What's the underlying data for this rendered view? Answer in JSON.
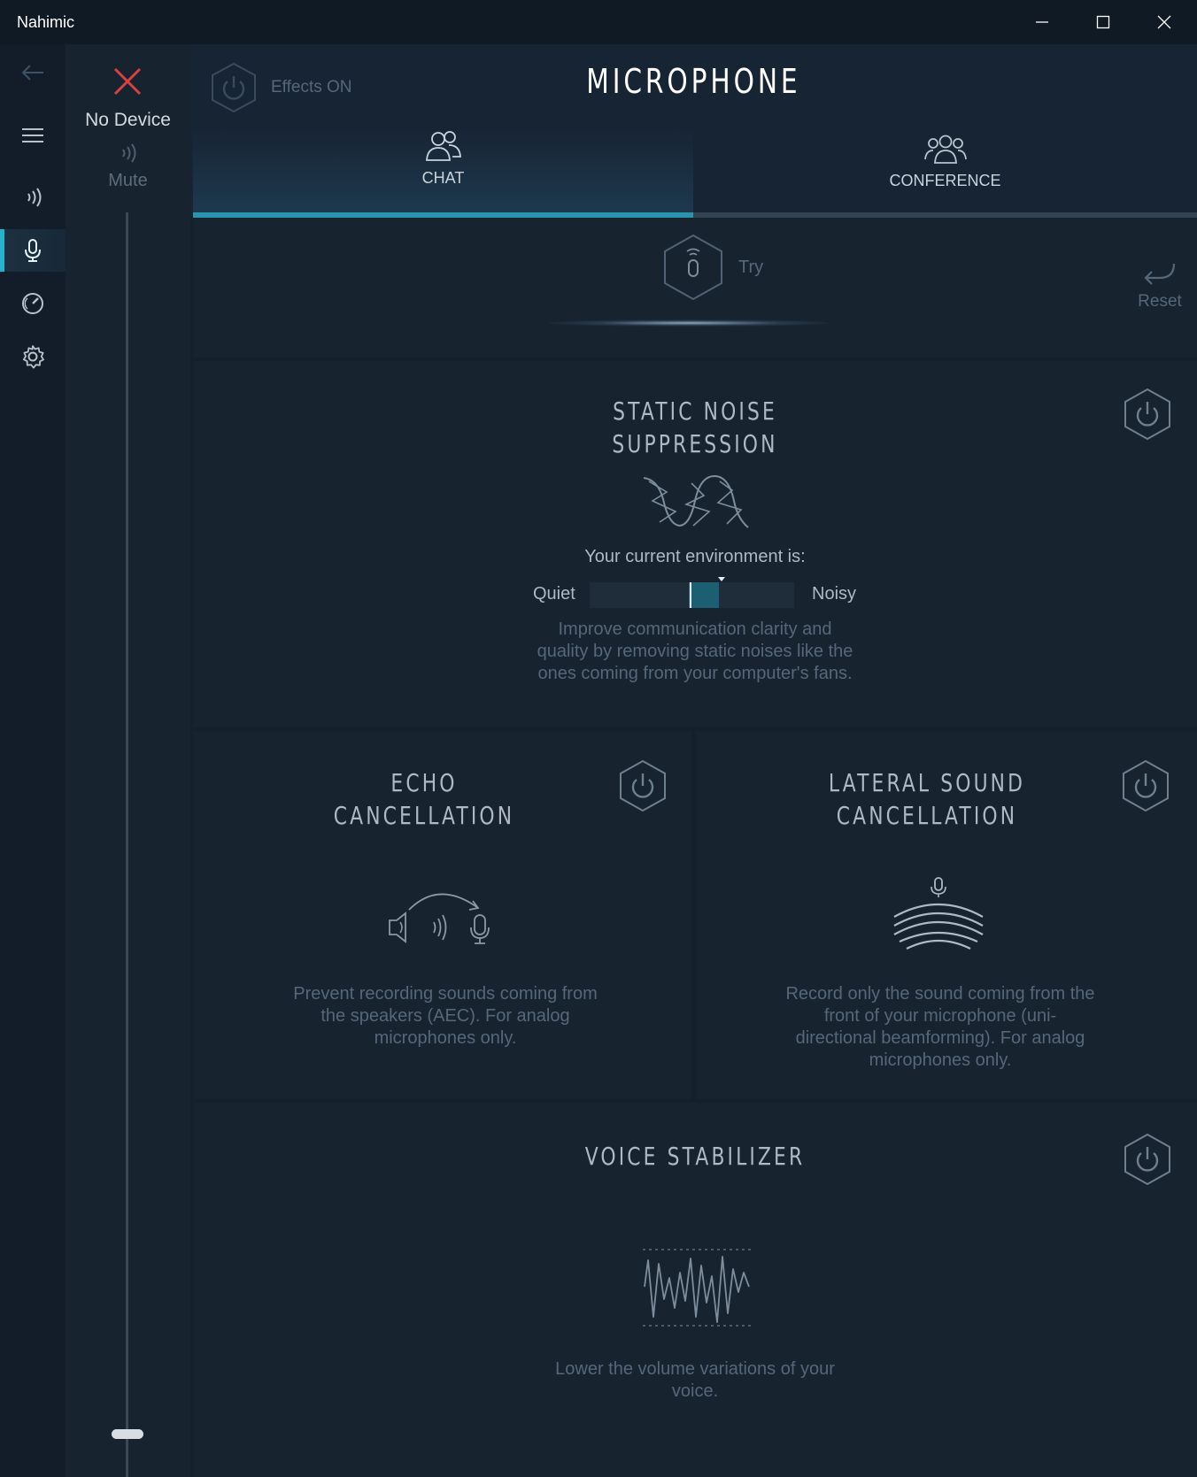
{
  "window": {
    "title": "Nahimic",
    "controls": {
      "minimize": "minimize-icon",
      "maximize": "maximize-icon",
      "close": "close-icon"
    }
  },
  "nav": {
    "items": [
      {
        "name": "back",
        "icon": "back-arrow-icon"
      },
      {
        "name": "menu",
        "icon": "hamburger-menu-icon"
      },
      {
        "name": "audio",
        "icon": "sound-waves-icon"
      },
      {
        "name": "microphone",
        "icon": "microphone-icon",
        "active": true
      },
      {
        "name": "sound-tracker",
        "icon": "radar-icon"
      },
      {
        "name": "settings",
        "icon": "gear-icon"
      }
    ],
    "accent": "#22b4cf"
  },
  "device": {
    "name": "No Device",
    "mute_label": "Mute",
    "volume_level": 0.0,
    "status_color": "#d9413f"
  },
  "header": {
    "effects_label": "Effects ON",
    "page_title": "MICROPHONE"
  },
  "tabs": [
    {
      "label": "CHAT",
      "active": true
    },
    {
      "label": "CONFERENCE",
      "active": false
    }
  ],
  "try_panel": {
    "try_label": "Try",
    "reset_label": "Reset"
  },
  "features": {
    "static_noise": {
      "title_line1": "STATIC NOISE",
      "title_line2": "SUPPRESSION",
      "environment_prompt": "Your current environment is:",
      "quiet_label": "Quiet",
      "noisy_label": "Noisy",
      "environment_level": 0.55,
      "description": "Improve communication clarity and quality by removing static noises like the ones coming from your computer's fans."
    },
    "echo": {
      "title_line1": "ECHO",
      "title_line2": "CANCELLATION",
      "description": "Prevent recording sounds coming from the speakers (AEC). For analog microphones only."
    },
    "lateral": {
      "title_line1": "LATERAL SOUND",
      "title_line2": "CANCELLATION",
      "description": "Record only the sound coming from the front of your microphone (uni-directional beamforming). For analog microphones only."
    },
    "voice_stabilizer": {
      "title": "VOICE STABILIZER",
      "description": "Lower the volume variations of your voice."
    }
  }
}
